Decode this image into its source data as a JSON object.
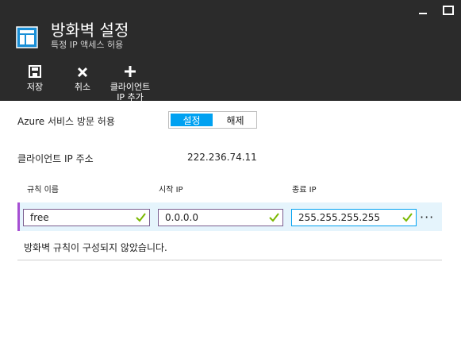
{
  "header": {
    "title": "방화벽 설정",
    "subtitle": "특정 IP 액세스 허용",
    "commands": [
      {
        "label": "저장",
        "icon": "save-icon"
      },
      {
        "label": "취소",
        "icon": "close-icon"
      },
      {
        "label": "클라이언트 IP 추가",
        "icon": "plus-icon"
      }
    ],
    "window_buttons": [
      "minimize-icon",
      "maximize-icon"
    ]
  },
  "azure_access": {
    "label": "Azure 서비스 방문 허용",
    "options": [
      "설정",
      "해제"
    ],
    "selected": "설정"
  },
  "client_ip": {
    "label": "클라이언트 IP 주소",
    "value": "222.236.74.11"
  },
  "rules_table": {
    "columns": [
      "규칙 이름",
      "시작 IP",
      "종료 IP"
    ],
    "rows": [
      {
        "name": "free",
        "start_ip": "0.0.0.0",
        "end_ip": "255.255.255.255"
      }
    ],
    "empty_message": "방화벽 규칙이 구성되지 않았습니다."
  },
  "colors": {
    "header_bg": "#2b2b2b",
    "accent": "#00a1f1",
    "valid_check": "#7ab800",
    "row_marker": "#a64fd3"
  }
}
